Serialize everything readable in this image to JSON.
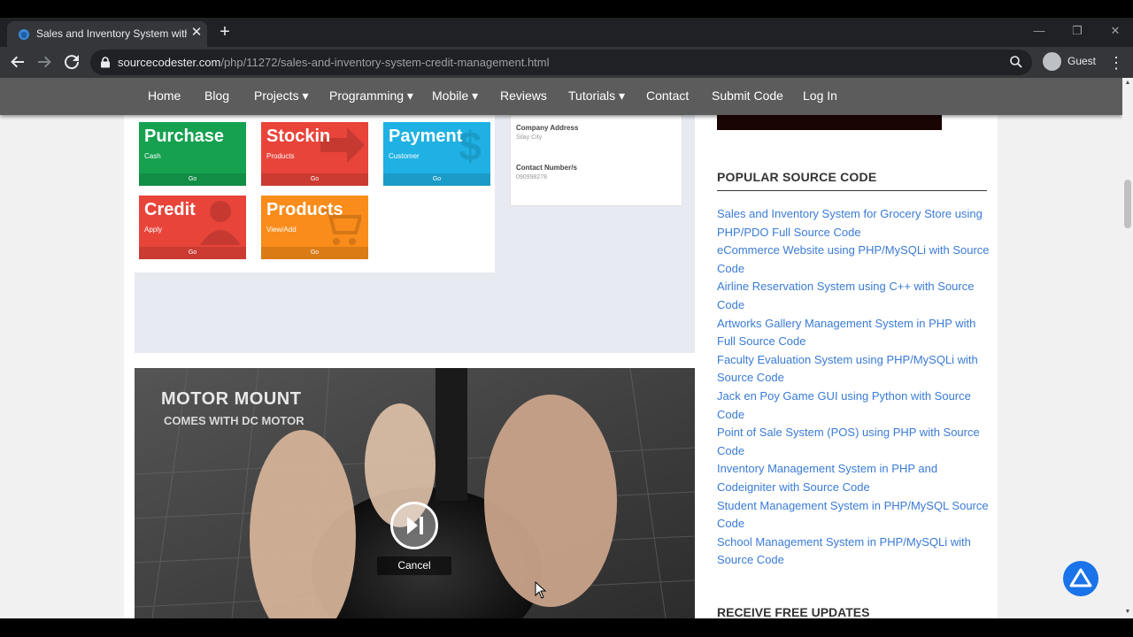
{
  "browser": {
    "tab_title": "Sales and Inventory System with",
    "tab_close": "✕",
    "new_tab": "+",
    "url_host": "sourcecodester.com",
    "url_path": "/php/11272/sales-and-inventory-system-credit-management.html",
    "profile_label": "Guest",
    "window_controls": [
      "—",
      "❐",
      "✕"
    ],
    "icons": [
      "back-icon",
      "forward-icon",
      "reload-icon",
      "lock-icon",
      "zoom-icon",
      "profile-icon",
      "menu-icon"
    ]
  },
  "site_nav": {
    "items": [
      {
        "label": "Home"
      },
      {
        "label": "Blog"
      },
      {
        "label": "Projects ▾"
      },
      {
        "label": "Programming ▾"
      },
      {
        "label": "Mobile ▾"
      },
      {
        "label": "Reviews"
      },
      {
        "label": "Tutorials ▾"
      },
      {
        "label": "Contact"
      },
      {
        "label": "Submit Code"
      },
      {
        "label": "Log In"
      }
    ]
  },
  "app_screenshot": {
    "tiles": [
      {
        "title": "Purchase",
        "sub": "Cash",
        "go": "Go",
        "color": "#15a150"
      },
      {
        "title": "Stockin",
        "sub": "Products",
        "go": "Go",
        "color": "#e8443a"
      },
      {
        "title": "Payment",
        "sub": "Customer",
        "go": "Go",
        "color": "#1fb1e3"
      },
      {
        "title": "Credit",
        "sub": "Apply",
        "go": "Go",
        "color": "#e8443a"
      },
      {
        "title": "Products",
        "sub": "View/Add",
        "go": "Go",
        "color": "#f98c1a"
      }
    ],
    "info": {
      "address_label": "Company Address",
      "address_value": "Silay City",
      "contact_label": "Contact Number/s",
      "contact_value": "090998278"
    }
  },
  "video": {
    "title": "MOTOR MOUNT",
    "subtitle": "COMES WITH DC MOTOR",
    "cancel_label": "Cancel"
  },
  "sidebar": {
    "popular_heading": "POPULAR SOURCE CODE",
    "popular_links": [
      "Sales and Inventory System for Grocery Store using PHP/PDO Full Source Code",
      "eCommerce Website using PHP/MySQLi with Source Code",
      "Airline Reservation System using C++ with Source Code",
      "Artworks Gallery Management System in PHP with Full Source Code",
      "Faculty Evaluation System using PHP/MySQLi with Source Code",
      "Jack en Poy Game GUI using Python with Source Code",
      "Point of Sale System (POS) using PHP with Source Code",
      "Inventory Management System in PHP and Codeigniter with Source Code",
      "Student Management System in PHP/MySQL Source Code",
      "School Management System in PHP/MySQLi with Source Code"
    ],
    "updates_heading": "RECEIVE FREE UPDATES"
  }
}
